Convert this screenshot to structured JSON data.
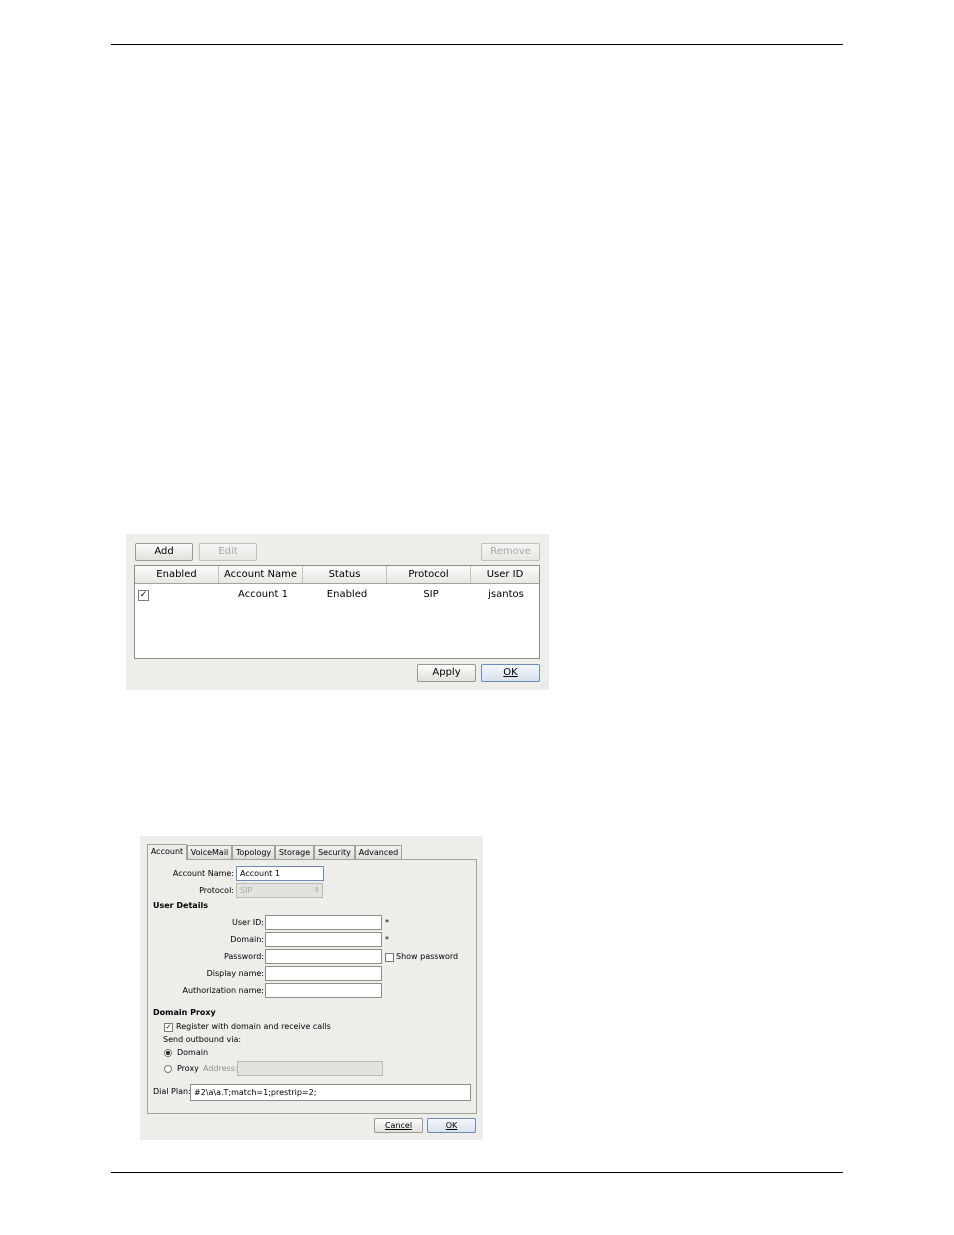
{
  "accounts_dialog": {
    "buttons": {
      "add": "Add",
      "edit": "Edit",
      "remove": "Remove",
      "apply": "Apply",
      "ok": "OK"
    },
    "columns": [
      "Enabled",
      "Account Name",
      "Status",
      "Protocol",
      "User ID"
    ],
    "rows": [
      {
        "enabled": true,
        "account_name": "Account 1",
        "status": "Enabled",
        "protocol": "SIP",
        "user_id": "jsantos"
      }
    ]
  },
  "account_properties_dialog": {
    "tabs": [
      "Account",
      "VoiceMail",
      "Topology",
      "Storage",
      "Security",
      "Advanced"
    ],
    "active_tab": "Account",
    "account_name": {
      "label": "Account Name:",
      "value": "Account 1"
    },
    "protocol": {
      "label": "Protocol:",
      "value": "SIP"
    },
    "user_details": {
      "heading": "User Details",
      "user_id": {
        "label": "User ID:",
        "value": "",
        "required_mark": "*"
      },
      "domain": {
        "label": "Domain:",
        "value": "",
        "required_mark": "*"
      },
      "password": {
        "label": "Password:",
        "value": ""
      },
      "show_password": {
        "label": "Show password",
        "checked": false
      },
      "display_name": {
        "label": "Display name:",
        "value": ""
      },
      "authorization_name": {
        "label": "Authorization name:",
        "value": ""
      }
    },
    "domain_proxy": {
      "heading": "Domain Proxy",
      "register": {
        "label": "Register with domain and receive calls",
        "checked": true
      },
      "send_outbound_via": "Send outbound via:",
      "option_domain": {
        "label": "Domain",
        "selected": true
      },
      "option_proxy": {
        "label": "Proxy",
        "selected": false
      },
      "address": {
        "label": "Address:",
        "value": ""
      }
    },
    "dial_plan": {
      "label": "Dial Plan:",
      "value": "#2\\a\\a.T;match=1;prestrip=2;"
    },
    "buttons": {
      "cancel": "Cancel",
      "ok": "OK"
    }
  }
}
